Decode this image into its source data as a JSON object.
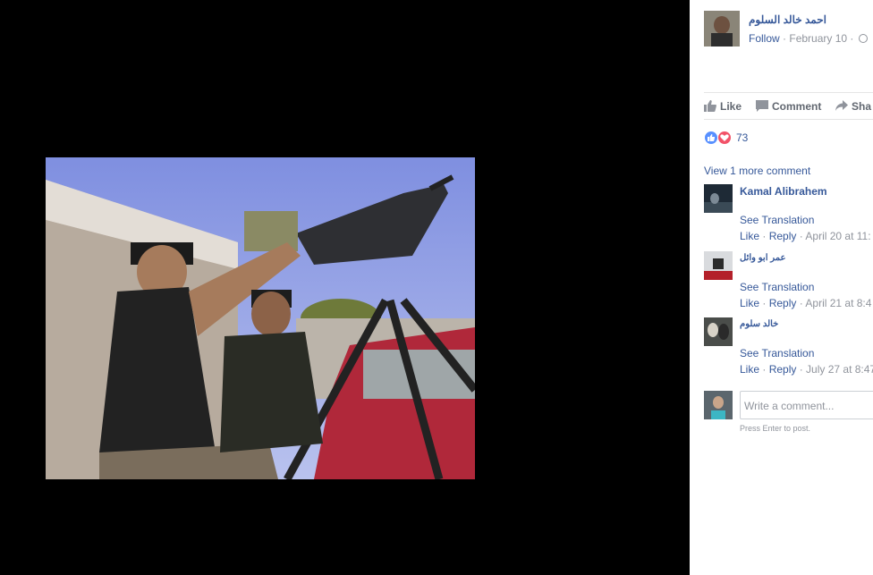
{
  "post": {
    "author_name": "احمد خالد السلوم",
    "follow_label": "Follow",
    "date": "February 10"
  },
  "actions": {
    "like": "Like",
    "comment": "Comment",
    "share": "Sha"
  },
  "reactions": {
    "count": "73"
  },
  "comments": {
    "view_more": "View 1 more comment",
    "items": [
      {
        "name": "Kamal Alibrahem",
        "translate": "See Translation",
        "like": "Like",
        "reply": "Reply",
        "time": "April 20 at 11:"
      },
      {
        "name": "عمر ابو وائل",
        "translate": "See Translation",
        "like": "Like",
        "reply": "Reply",
        "time": "April 21 at 8:4"
      },
      {
        "name": "خالد سلوم",
        "translate": "See Translation",
        "like": "Like",
        "reply": "Reply",
        "time": "July 27 at 8:47"
      }
    ]
  },
  "composer": {
    "placeholder": "Write a comment...",
    "hint": "Press Enter to post."
  },
  "colors": {
    "link": "#365899",
    "meta": "#90949c",
    "like_reaction": "#5890ff",
    "love_reaction": "#f25268"
  }
}
